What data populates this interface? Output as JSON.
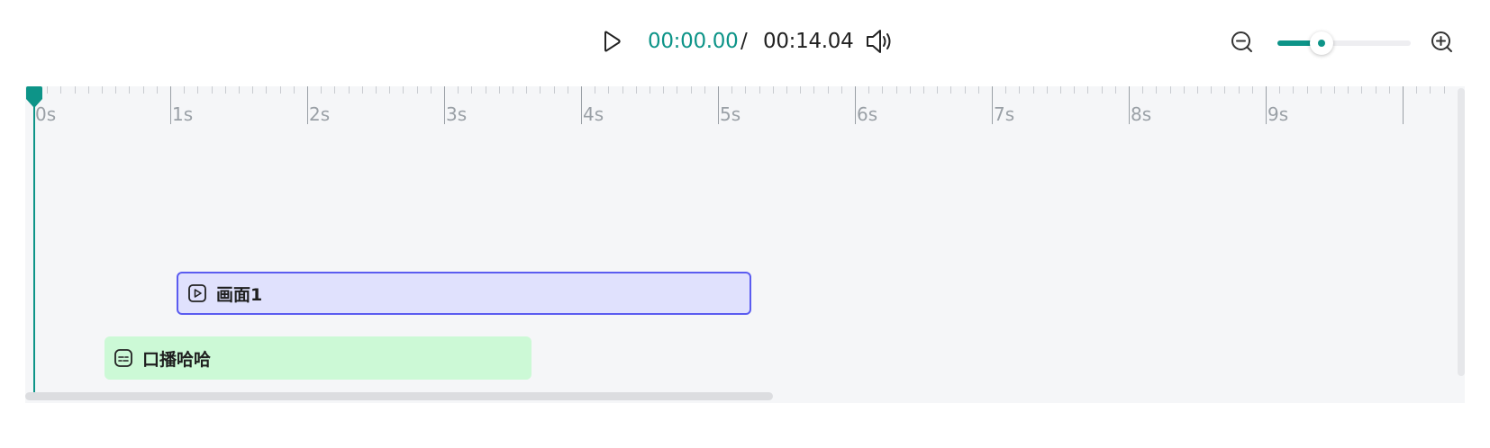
{
  "player": {
    "current_time": "00:00.00",
    "separator": "/",
    "total_time": "00:14.04",
    "play_icon": "play-icon",
    "volume_icon": "volume-icon"
  },
  "zoom": {
    "zoom_out_icon": "zoom-out-icon",
    "zoom_in_icon": "zoom-in-icon",
    "level_fraction": 0.33
  },
  "timeline": {
    "ruler_labels": [
      "0s",
      "1s",
      "2s",
      "3s",
      "4s",
      "5s",
      "6s",
      "7s",
      "8s",
      "9s"
    ],
    "playhead_time": "0s",
    "tracks": [
      {
        "type": "video",
        "icon": "video-clip-icon",
        "label": "画面1"
      },
      {
        "type": "caption",
        "icon": "subtitle-clip-icon",
        "label": "口播哈哈"
      }
    ]
  },
  "colors": {
    "accent": "#0d9488",
    "video_clip_bg": "#e0e1fd",
    "video_clip_border": "#5b5cf0",
    "caption_clip_bg": "#ccf9d6",
    "timeline_bg": "#f5f6f8"
  }
}
